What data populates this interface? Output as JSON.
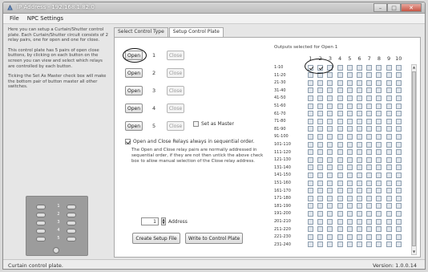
{
  "window": {
    "title": "IP Address - 192.168.1.82.0"
  },
  "menu": {
    "items": [
      "File",
      "NPC Settings"
    ]
  },
  "help": {
    "paragraphs": [
      "Here you can setup a Curtain/Shutter control plate. Each Curtain/Shutter circuit consists of 2 relay pairs, one for open and one for close.",
      "This control plate has 5 pairs of open close buttons, by clicking on each button on the screen you can view and select which relays are controlled by each button.",
      "Ticking the Set As Master check box will make the bottom pair of button master all other switches."
    ]
  },
  "plate": {
    "rows": [
      "1",
      "2",
      "3",
      "4",
      "5"
    ]
  },
  "tabs": [
    "Select Control Type",
    "Setup Control Plate"
  ],
  "controls": {
    "rows": [
      {
        "open": "Open",
        "num": "1",
        "close": "Close"
      },
      {
        "open": "Open",
        "num": "2",
        "close": "Close"
      },
      {
        "open": "Open",
        "num": "3",
        "close": "Close"
      },
      {
        "open": "Open",
        "num": "4",
        "close": "Close"
      },
      {
        "open": "Open",
        "num": "5",
        "close": "Close"
      }
    ],
    "master_label": "Set as Master",
    "sequential_label": "Open and Close Relays always in sequential order.",
    "sequential_desc": "The Open and Close relay pairs are normally addressed in sequential order, if they are not then untick the above check box to allow manual selection of the Close relay address.",
    "address_value": "1",
    "address_label": "Address",
    "create_button": "Create Setup File",
    "write_button": "Write to Control Plate"
  },
  "outputs": {
    "caption": "Outputs selected for Open 1",
    "columns": [
      "1",
      "2",
      "3",
      "4",
      "5",
      "6",
      "7",
      "8",
      "9",
      "10"
    ],
    "rows": [
      "1-10",
      "11-20",
      "21-30",
      "31-40",
      "41-50",
      "51-60",
      "61-70",
      "71-80",
      "81-90",
      "91-100",
      "101-110",
      "111-120",
      "121-130",
      "131-140",
      "141-150",
      "151-160",
      "161-170",
      "171-180",
      "181-190",
      "191-200",
      "201-210",
      "211-220",
      "221-230",
      "231-240"
    ],
    "checked": [
      [
        0,
        0
      ],
      [
        0,
        1
      ]
    ]
  },
  "status": {
    "left": "Curtain control plate.",
    "right": "Version: 1.0.0.14"
  }
}
